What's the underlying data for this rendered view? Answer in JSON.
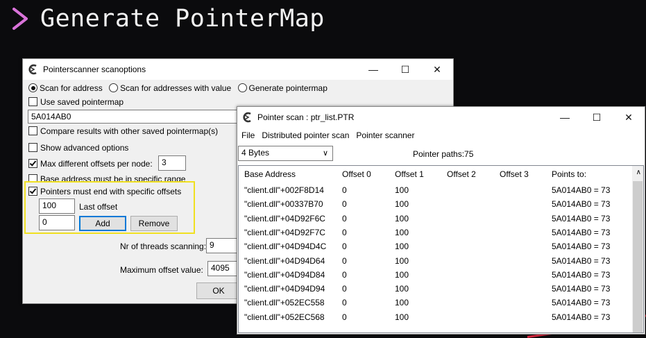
{
  "slide": {
    "title": "Generate PointerMap",
    "accent": "#d973d9"
  },
  "scanoptions": {
    "title": "Pointerscanner scanoptions",
    "radios": [
      {
        "label": "Scan for address",
        "selected": true
      },
      {
        "label": "Scan for addresses with value",
        "selected": false
      },
      {
        "label": "Generate pointermap",
        "selected": false
      }
    ],
    "use_saved_pointermap": "Use saved pointermap",
    "address_value": "5A014AB0",
    "compare_results": "Compare results with other saved pointermap(s)",
    "show_advanced": "Show advanced options",
    "max_offsets_label": "Max different offsets per node:",
    "max_offsets_value": "3",
    "base_address_range": "Base address must be in specific range",
    "pointers_end": "Pointers must end with specific offsets",
    "last_offset_value": "100",
    "last_offset_label": "Last offset",
    "new_offset_value": "0",
    "add_label": "Add",
    "remove_label": "Remove",
    "threads_label": "Nr of threads scanning:",
    "threads_value": "9",
    "max_offset_label": "Maximum offset value:",
    "max_offset_value": "4095",
    "ok_label": "OK",
    "highlight_color": "#f0e020"
  },
  "pointerscan": {
    "title": "Pointer scan : ptr_list.PTR",
    "menu": [
      "File",
      "Distributed pointer scan",
      "Pointer scanner"
    ],
    "type_value": "4 Bytes",
    "paths_label": "Pointer paths:75",
    "columns": [
      "Base Address",
      "Offset 0",
      "Offset 1",
      "Offset 2",
      "Offset 3",
      "Points to:"
    ],
    "rows": [
      [
        "\"client.dll\"+002F8D14",
        "0",
        "100",
        "",
        "",
        "5A014AB0 = 73"
      ],
      [
        "\"client.dll\"+00337B70",
        "0",
        "100",
        "",
        "",
        "5A014AB0 = 73"
      ],
      [
        "\"client.dll\"+04D92F6C",
        "0",
        "100",
        "",
        "",
        "5A014AB0 = 73"
      ],
      [
        "\"client.dll\"+04D92F7C",
        "0",
        "100",
        "",
        "",
        "5A014AB0 = 73"
      ],
      [
        "\"client.dll\"+04D94D4C",
        "0",
        "100",
        "",
        "",
        "5A014AB0 = 73"
      ],
      [
        "\"client.dll\"+04D94D64",
        "0",
        "100",
        "",
        "",
        "5A014AB0 = 73"
      ],
      [
        "\"client.dll\"+04D94D84",
        "0",
        "100",
        "",
        "",
        "5A014AB0 = 73"
      ],
      [
        "\"client.dll\"+04D94D94",
        "0",
        "100",
        "",
        "",
        "5A014AB0 = 73"
      ],
      [
        "\"client.dll\"+052EC558",
        "0",
        "100",
        "",
        "",
        "5A014AB0 = 73"
      ],
      [
        "\"client.dll\"+052EC568",
        "0",
        "100",
        "",
        "",
        "5A014AB0 = 73"
      ]
    ]
  }
}
